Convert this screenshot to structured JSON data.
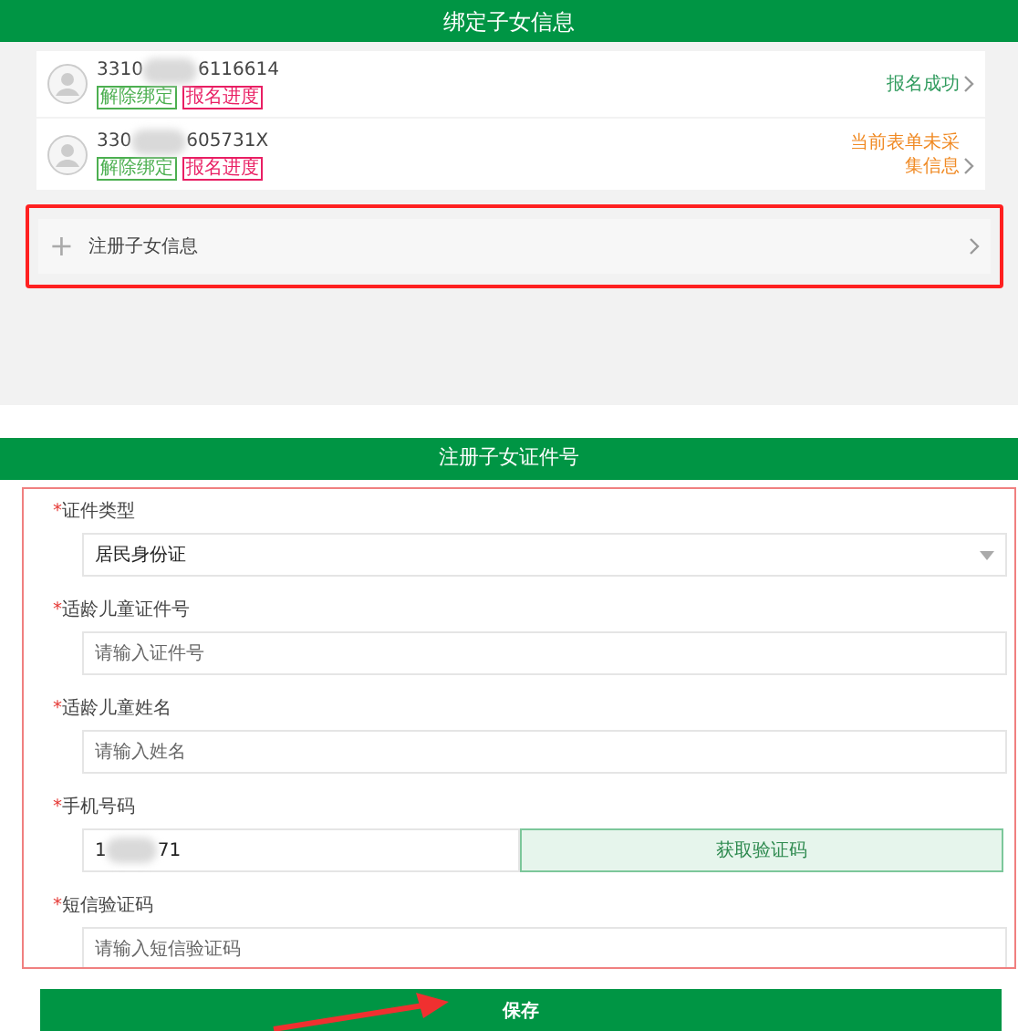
{
  "bound_header": {
    "title": "绑定子女信息"
  },
  "children": [
    {
      "id_prefix": "3310",
      "id_suffix": "6116614",
      "actions": [
        "解除绑定",
        "报名进度"
      ],
      "status": "报名成功",
      "kind": "success"
    },
    {
      "id_prefix": "330",
      "id_suffix": "605731X",
      "actions": [
        "解除绑定",
        "报名进度"
      ],
      "status": "当前表单未采集信息",
      "kind": "warning"
    }
  ],
  "add_child": {
    "icon": "+",
    "label": "注册子女信息"
  },
  "form_header": {
    "title": "注册子女证件号"
  },
  "fields": [
    {
      "kind": "select",
      "marker": "*",
      "label": "证件类型",
      "value": "居民身份证"
    },
    {
      "kind": "text",
      "marker": "*",
      "label": "适龄儿童证件号",
      "placeholder": "请输入证件号"
    },
    {
      "kind": "text",
      "marker": "*",
      "label": "适龄儿童姓名",
      "placeholder": "请输入姓名"
    },
    {
      "kind": "phone",
      "marker": "*",
      "label": "手机号码",
      "value_prefix": "1",
      "value_suffix": "71",
      "button": "获取验证码"
    },
    {
      "kind": "text",
      "marker": "*",
      "label": "短信验证码",
      "placeholder": "请输入短信验证码"
    }
  ],
  "save_button": "保存"
}
